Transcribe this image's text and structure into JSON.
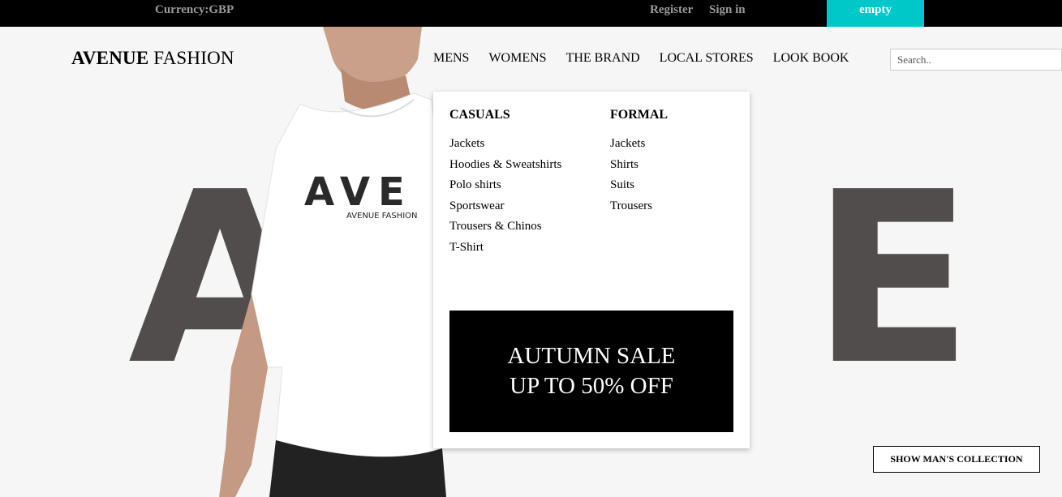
{
  "topbar": {
    "currency": "Currency:GBP",
    "register": "Register",
    "signin": "Sign in",
    "cart": "empty"
  },
  "brand": {
    "bold": "AVENUE",
    "light": " FASHION"
  },
  "nav": [
    "MENS",
    "WOMENS",
    "THE BRAND",
    "LOCAL STORES",
    "LOOK BOOK"
  ],
  "search": {
    "placeholder": "Search.."
  },
  "hero": {
    "letter_left": "A",
    "letter_right": "E",
    "shirt_print": "AVE",
    "shirt_brand": "AVENUE FASHION",
    "button": "SHOW MAN'S COLLECTION"
  },
  "mega_menu": {
    "casuals": {
      "title": "CASUALS",
      "items": [
        "Jackets",
        "Hoodies & Sweatshirts",
        "Polo shirts",
        "Sportswear",
        "Trousers & Chinos",
        "T-Shirt"
      ]
    },
    "formal": {
      "title": "FORMAL",
      "items": [
        "Jackets",
        "Shirts",
        "Suits",
        "Trousers"
      ]
    },
    "sale": {
      "line1": "AUTUMN SALE",
      "line2": "UP TO 50% OFF"
    }
  },
  "colors": {
    "topbar_bg": "#000000",
    "accent": "#00c8c8",
    "letters": "#524d4d"
  }
}
